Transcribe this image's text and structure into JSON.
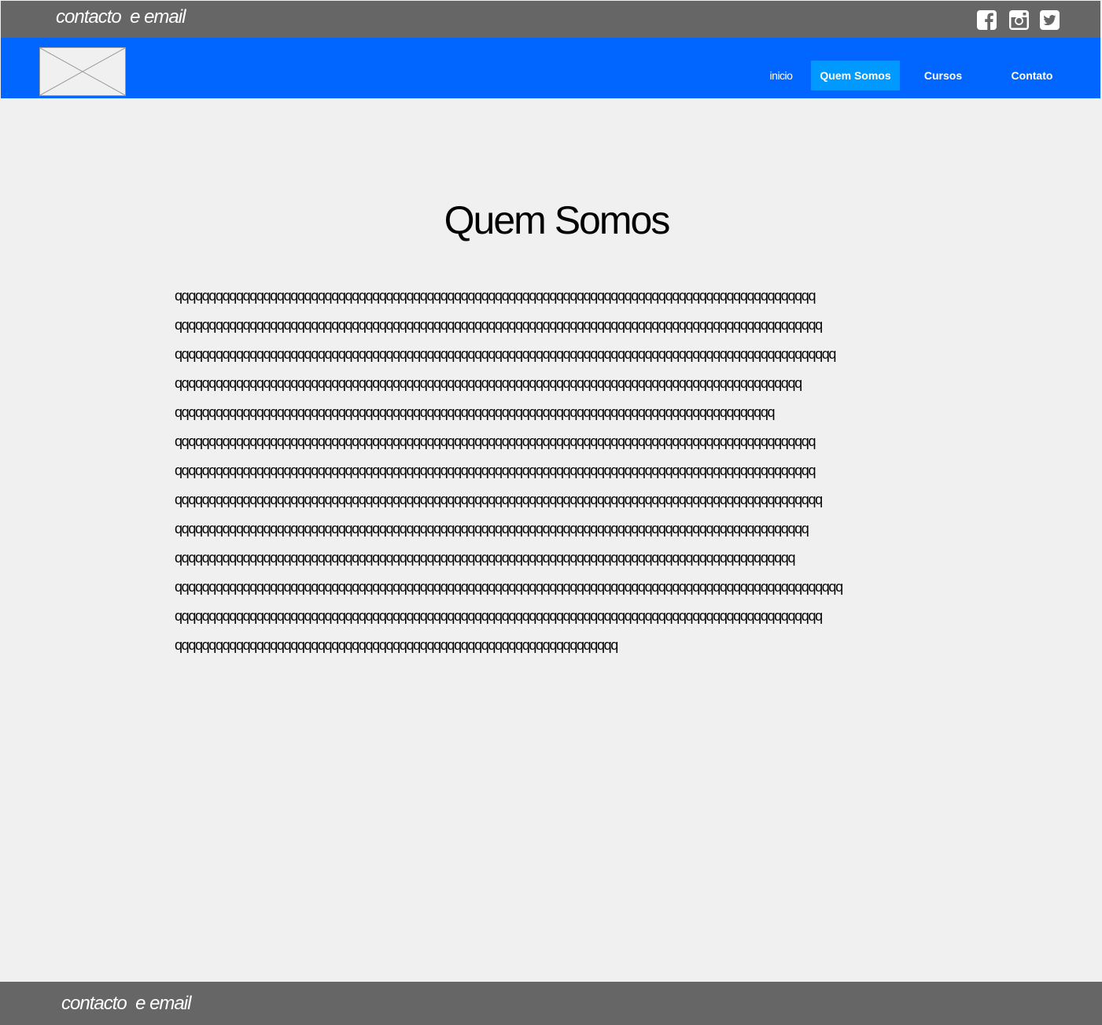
{
  "header": {
    "contact_text": "contacto  e email",
    "social_icons": [
      "facebook-icon",
      "instagram-icon",
      "twitter-icon"
    ]
  },
  "nav": {
    "logo_placeholder": "image-placeholder",
    "items": [
      {
        "label": "inicio",
        "active": false
      },
      {
        "label": "Quem Somos",
        "active": true
      },
      {
        "label": "Cursos",
        "active": false
      },
      {
        "label": "Contato",
        "active": false
      }
    ]
  },
  "main": {
    "title": "Quem Somos",
    "lines": [
      "qqqqqqqqqqqqqqqqqqqqqqqqqqqqqqqqqqqqqqqqqqqqqqqqqqqqqqqqqqqqqqqqqqqqqqqqqqqqqqqqqqqqqqqqqqqqqq",
      "qqqqqqqqqqqqqqqqqqqqqqqqqqqqqqqqqqqqqqqqqqqqqqqqqqqqqqqqqqqqqqqqqqqqqqqqqqqqqqqqqqqqqqqqqqqqqqq",
      "qqqqqqqqqqqqqqqqqqqqqqqqqqqqqqqqqqqqqqqqqqqqqqqqqqqqqqqqqqqqqqqqqqqqqqqqqqqqqqqqqqqqqqqqqqqqqqqqq",
      "qqqqqqqqqqqqqqqqqqqqqqqqqqqqqqqqqqqqqqqqqqqqqqqqqqqqqqqqqqqqqqqqqqqqqqqqqqqqqqqqqqqqqqqqqqqq",
      "qqqqqqqqqqqqqqqqqqqqqqqqqqqqqqqqqqqqqqqqqqqqqqqqqqqqqqqqqqqqqqqqqqqqqqqqqqqqqqqqqqqqqqqq",
      "qqqqqqqqqqqqqqqqqqqqqqqqqqqqqqqqqqqqqqqqqqqqqqqqqqqqqqqqqqqqqqqqqqqqqqqqqqqqqqqqqqqqqqqqqqqqqq",
      "qqqqqqqqqqqqqqqqqqqqqqqqqqqqqqqqqqqqqqqqqqqqqqqqqqqqqqqqqqqqqqqqqqqqqqqqqqqqqqqqqqqqqqqqqqqqqq",
      "qqqqqqqqqqqqqqqqqqqqqqqqqqqqqqqqqqqqqqqqqqqqqqqqqqqqqqqqqqqqqqqqqqqqqqqqqqqqqqqqqqqqqqqqqqqqqqq",
      "qqqqqqqqqqqqqqqqqqqqqqqqqqqqqqqqqqqqqqqqqqqqqqqqqqqqqqqqqqqqqqqqqqqqqqqqqqqqqqqqqqqqqqqqqqqqq",
      "qqqqqqqqqqqqqqqqqqqqqqqqqqqqqqqqqqqqqqqqqqqqqqqqqqqqqqqqqqqqqqqqqqqqqqqqqqqqqqqqqqqqqqqqqqq",
      "qqqqqqqqqqqqqqqqqqqqqqqqqqqqqqqqqqqqqqqqqqqqqqqqqqqqqqqqqqqqqqqqqqqqqqqqqqqqqqqqqqqqqqqqqqqqqqqqqq",
      "qqqqqqqqqqqqqqqqqqqqqqqqqqqqqqqqqqqqqqqqqqqqqqqqqqqqqqqqqqqqqqqqqqqqqqqqqqqqqqqqqqqqqqqqqqqqqqq",
      "qqqqqqqqqqqqqqqqqqqqqqqqqqqqqqqqqqqqqqqqqqqqqqqqqqqqqqqqqqqqqqqqq"
    ]
  },
  "footer": {
    "contact_text": "contacto  e email"
  },
  "colors": {
    "topbar": "#666666",
    "navbar": "#0066ff",
    "nav_active": "#0099ff",
    "background": "#f0f0f0",
    "footer": "#666666"
  }
}
